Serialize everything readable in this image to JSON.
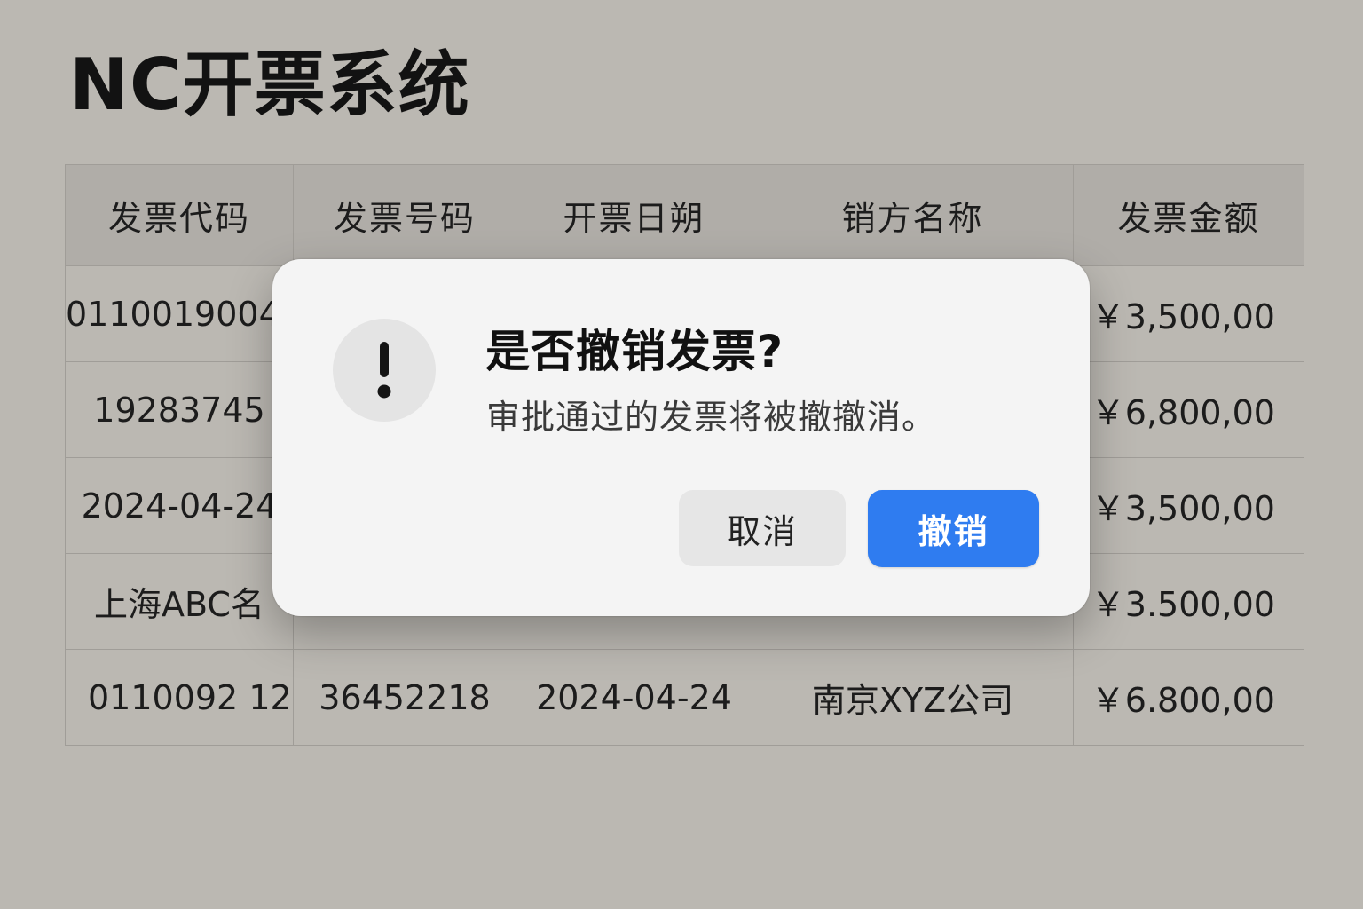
{
  "app": {
    "title": "NC开票系统"
  },
  "table": {
    "columns": [
      "发票代码",
      "发票号码",
      "开票日朔",
      "销方名称",
      "发票金额"
    ],
    "rows": [
      {
        "code": "01100190041",
        "number": "",
        "date": "",
        "seller": "",
        "amount": "￥3,500,00"
      },
      {
        "code": "19283745",
        "number": "",
        "date": "",
        "seller": "",
        "amount": "￥6,800,00"
      },
      {
        "code": "2024-04-24",
        "number": "",
        "date": "",
        "seller": "",
        "amount": "￥3,500,00"
      },
      {
        "code": "上海ABC名",
        "number": "",
        "date": "",
        "seller": "",
        "amount": "￥3.500,00"
      },
      {
        "code": "0110092  12",
        "number": "36452218",
        "date": "2024-04-24",
        "seller": "南京XYZ公司",
        "amount": "￥6.800,00"
      }
    ]
  },
  "dialog": {
    "icon": "exclamation-icon",
    "title": "是否撤销发票?",
    "message": "审批通过的发票将被撤撤消。",
    "cancel_label": "取消",
    "confirm_label": "撤销",
    "colors": {
      "confirm_bg": "#2f7cf0",
      "cancel_bg": "#e6e6e6",
      "dialog_bg": "#f4f4f4",
      "page_bg": "#bbb8b2"
    }
  }
}
